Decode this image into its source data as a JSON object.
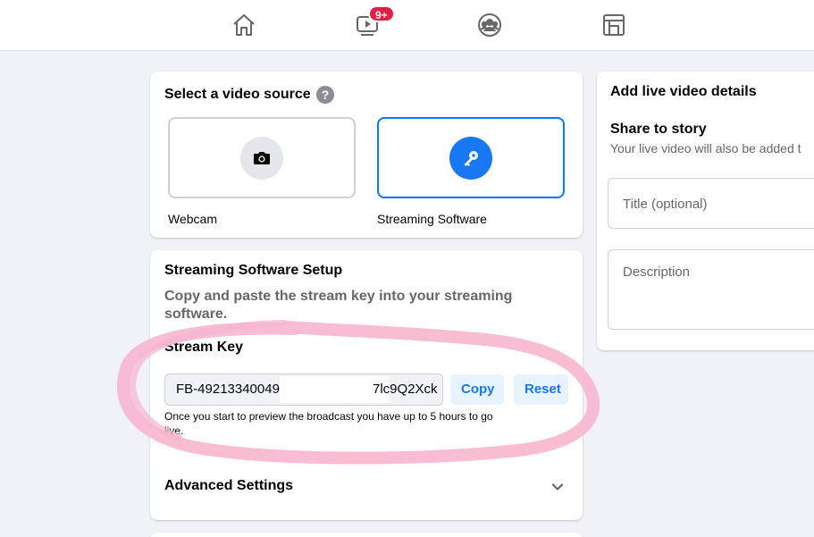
{
  "nav": {
    "notification_badge": "9+",
    "icons": [
      "home-icon",
      "watch-icon",
      "groups-icon",
      "gaming-icon"
    ]
  },
  "video_source": {
    "title": "Select a video source",
    "help": "?",
    "options": [
      {
        "label": "Webcam",
        "icon": "camera-icon",
        "selected": false
      },
      {
        "label": "Streaming Software",
        "icon": "key-icon",
        "selected": true
      }
    ]
  },
  "setup": {
    "title": "Streaming Software Setup",
    "instructions": "Copy and paste the stream key into your streaming software.",
    "stream_key_label": "Stream Key",
    "stream_key_value": "FB-49213340049",
    "stream_key_tail": "7lc9Q2Xck",
    "copy_label": "Copy",
    "reset_label": "Reset",
    "note": "Once you start to preview the broadcast you have up to 5 hours to go live.",
    "advanced_label": "Advanced Settings"
  },
  "details": {
    "title": "Add live video details",
    "share_title": "Share to story",
    "share_desc": "Your live video will also be added t",
    "title_placeholder": "Title (optional)",
    "description_placeholder": "Description"
  },
  "colors": {
    "accent": "#1877f2",
    "badge": "#e41e3f",
    "annotation": "#f7b6cf"
  }
}
